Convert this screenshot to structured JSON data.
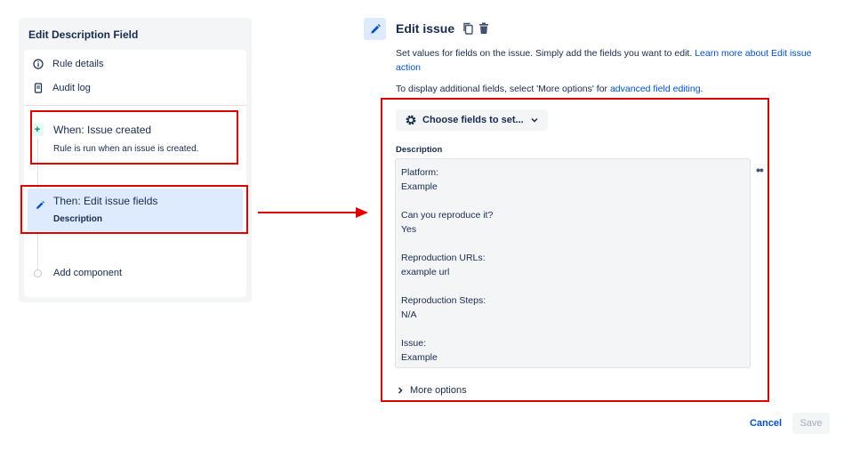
{
  "left_panel": {
    "title": "Edit Description Field",
    "nav": [
      {
        "label": "Rule details",
        "icon": "info-icon"
      },
      {
        "label": "Audit log",
        "icon": "document-icon"
      }
    ],
    "trigger": {
      "badge": "+",
      "title": "When: Issue created",
      "desc": "Rule is run when an issue is created."
    },
    "action": {
      "title": "Then: Edit issue fields",
      "subtitle": "Description"
    },
    "add_component": "Add component"
  },
  "right_panel": {
    "title": "Edit issue",
    "intro_text": "Set values for fields on the issue. Simply add the fields you want to edit. ",
    "intro_link": "Learn more about Edit issue action",
    "intro2_text": "To display additional fields, select 'More options' for ",
    "intro2_link": "advanced field editing",
    "intro2_end": ".",
    "choose_fields": "Choose fields to set...",
    "field_label": "Description",
    "description_value": "Platform:\nExample\n\nCan you reproduce it?\nYes\n\nReproduction URLs:\nexample url\n\nReproduction Steps:\nN/A\n\nIssue:\nExample",
    "more_options": "More options",
    "cancel": "Cancel",
    "save": "Save"
  },
  "colors": {
    "accent": "#0052cc",
    "highlight": "#e00000",
    "selected_bg": "#deebff",
    "panel_bg": "#f4f5f7"
  }
}
